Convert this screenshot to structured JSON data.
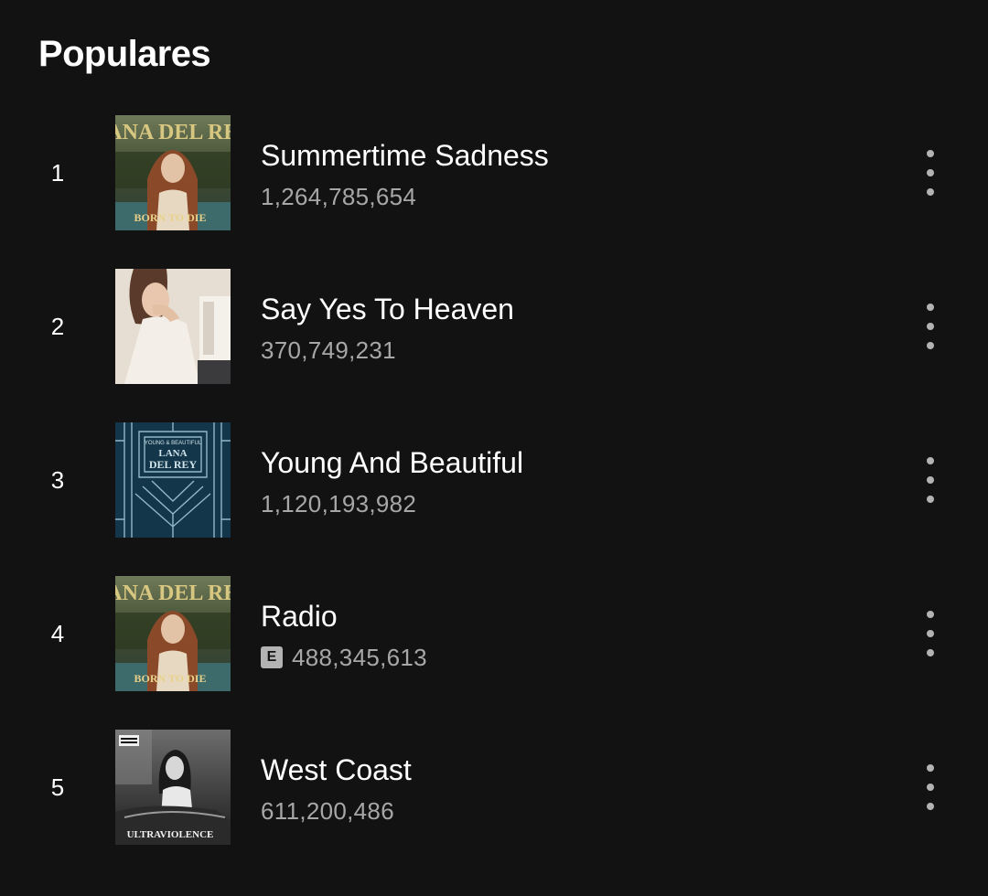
{
  "section": {
    "title": "Populares"
  },
  "tracks": [
    {
      "rank": "1",
      "title": "Summertime Sadness",
      "plays": "1,264,785,654",
      "explicit": false,
      "cover": "born-to-die-paradise-edition",
      "cover_text_top": "LANA DEL REY",
      "cover_text_bottom": "BORN TO DIE"
    },
    {
      "rank": "2",
      "title": "Say Yes To Heaven",
      "plays": "370,749,231",
      "explicit": false,
      "cover": "say-yes-to-heaven"
    },
    {
      "rank": "3",
      "title": "Young And Beautiful",
      "plays": "1,120,193,982",
      "explicit": false,
      "cover": "young-and-beautiful",
      "cover_text_top": "YOUNG & BEAUTIFUL",
      "cover_text_mid1": "LANA",
      "cover_text_mid2": "DEL REY"
    },
    {
      "rank": "4",
      "title": "Radio",
      "plays": "488,345,613",
      "explicit": true,
      "explicit_label": "E",
      "cover": "born-to-die-paradise-edition",
      "cover_text_top": "LANA DEL REY",
      "cover_text_bottom": "BORN TO DIE"
    },
    {
      "rank": "5",
      "title": "West Coast",
      "plays": "611,200,486",
      "explicit": false,
      "cover": "ultraviolence",
      "cover_text_bottom": "ULTRAVIOLENCE"
    }
  ],
  "icons": {
    "more": "more-vertical-icon",
    "explicit": "explicit-badge-icon"
  },
  "colors": {
    "background": "#121212",
    "primary_text": "#ffffff",
    "secondary_text": "#a7a7a7",
    "icon": "#b3b3b3"
  }
}
